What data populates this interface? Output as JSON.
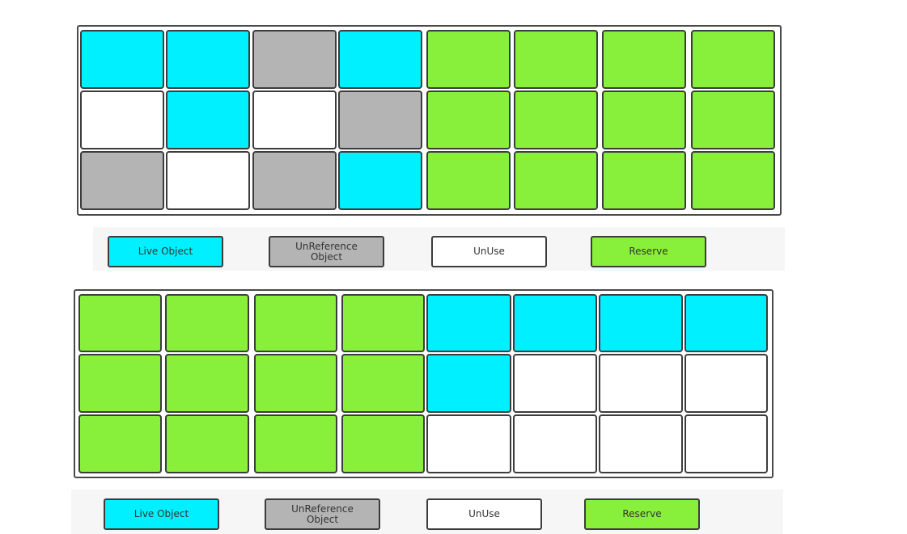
{
  "colors": {
    "live": "#00f0ff",
    "unreferenced": "#b4b4b4",
    "unuse": "#ffffff",
    "reserve": "#88f03a"
  },
  "diagrams": [
    {
      "grid": [
        [
          "live",
          "live",
          "unreferenced",
          "live",
          "reserve",
          "reserve",
          "reserve",
          "reserve"
        ],
        [
          "unuse",
          "live",
          "unuse",
          "unreferenced",
          "reserve",
          "reserve",
          "reserve",
          "reserve"
        ],
        [
          "unreferenced",
          "unuse",
          "unreferenced",
          "live",
          "reserve",
          "reserve",
          "reserve",
          "reserve"
        ]
      ],
      "legend": [
        {
          "key": "live",
          "label": "Live Object"
        },
        {
          "key": "unreferenced",
          "label": "UnReference\nObject"
        },
        {
          "key": "unuse",
          "label": "UnUse"
        },
        {
          "key": "reserve",
          "label": "Reserve"
        }
      ]
    },
    {
      "grid": [
        [
          "reserve",
          "reserve",
          "reserve",
          "reserve",
          "live",
          "live",
          "live",
          "live"
        ],
        [
          "reserve",
          "reserve",
          "reserve",
          "reserve",
          "live",
          "unuse",
          "unuse",
          "unuse"
        ],
        [
          "reserve",
          "reserve",
          "reserve",
          "reserve",
          "unuse",
          "unuse",
          "unuse",
          "unuse"
        ]
      ],
      "legend": [
        {
          "key": "live",
          "label": "Live Object"
        },
        {
          "key": "unreferenced",
          "label": "UnReference\nObject"
        },
        {
          "key": "unuse",
          "label": "UnUse"
        },
        {
          "key": "reserve",
          "label": "Reserve"
        }
      ]
    }
  ]
}
